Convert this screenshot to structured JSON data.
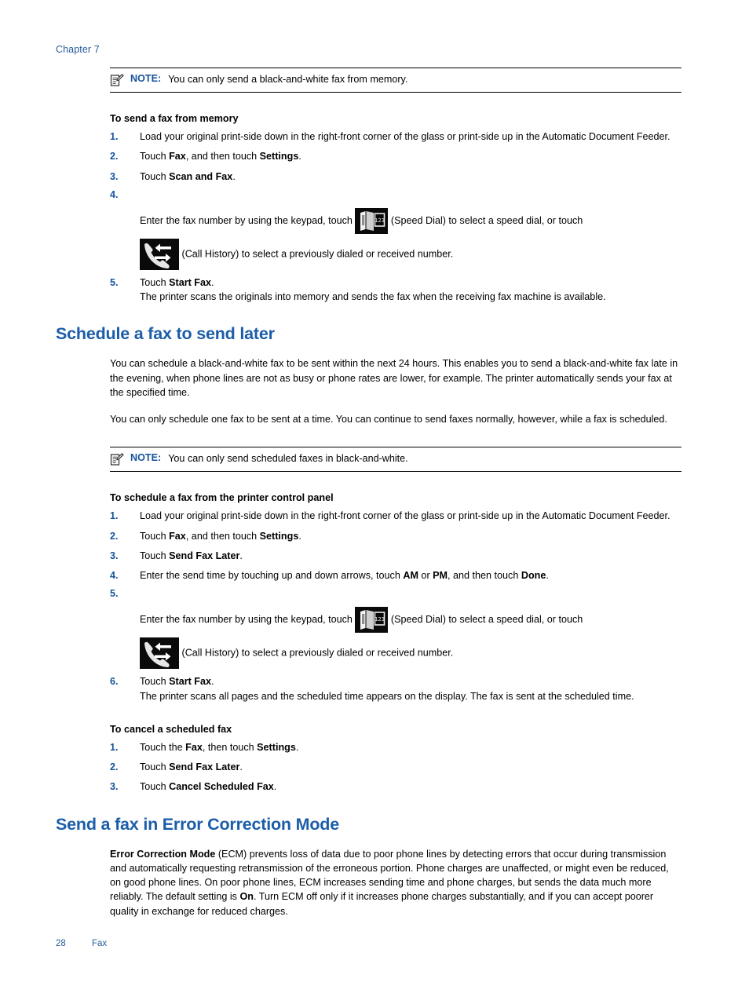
{
  "header": {
    "chapter": "Chapter 7"
  },
  "notes": [
    {
      "label": "NOTE:",
      "text": "You can only send a black-and-white fax from memory.",
      "icon": "note-pad-icon"
    },
    {
      "label": "NOTE:",
      "text": "You can only send scheduled faxes in black-and-white.",
      "icon": "note-pad-icon"
    }
  ],
  "procedures": [
    {
      "title": "To send a fax from memory",
      "steps": [
        {
          "num": "1.",
          "html": "Load your original print-side down in the right-front corner of the glass or print-side up in the Automatic Document Feeder."
        },
        {
          "num": "2.",
          "html": "Touch <b>Fax</b>, and then touch <b>Settings</b>."
        },
        {
          "num": "3.",
          "html": "Touch <b>Scan and Fax</b>."
        },
        {
          "num": "4.",
          "icon_step": true,
          "line1_before": "Enter the fax number by using the keypad, touch ",
          "line1_after": " (Speed Dial) to select a speed dial, or touch",
          "line2_after": " (Call History) to select a previously dialed or received number."
        },
        {
          "num": "5.",
          "html": "Touch <b>Start Fax</b>.",
          "sub": "The printer scans the originals into memory and sends the fax when the receiving fax machine is available."
        }
      ]
    },
    {
      "title": "To schedule a fax from the printer control panel",
      "steps": [
        {
          "num": "1.",
          "html": "Load your original print-side down in the right-front corner of the glass or print-side up in the Automatic Document Feeder."
        },
        {
          "num": "2.",
          "html": "Touch <b>Fax</b>, and then touch <b>Settings</b>."
        },
        {
          "num": "3.",
          "html": "Touch <b>Send Fax Later</b>."
        },
        {
          "num": "4.",
          "html": "Enter the send time by touching up and down arrows, touch <b>AM</b> or <b>PM</b>, and then touch <b>Done</b>."
        },
        {
          "num": "5.",
          "icon_step": true,
          "line1_before": "Enter the fax number by using the keypad, touch ",
          "line1_after": " (Speed Dial) to select a speed dial, or touch",
          "line2_after": " (Call History) to select a previously dialed or received number."
        },
        {
          "num": "6.",
          "html": "Touch <b>Start Fax</b>.",
          "sub": "The printer scans all pages and the scheduled time appears on the display. The fax is sent at the scheduled time."
        }
      ]
    },
    {
      "title": "To cancel a scheduled fax",
      "steps": [
        {
          "num": "1.",
          "html": "Touch the <b>Fax</b>, then touch <b>Settings</b>."
        },
        {
          "num": "2.",
          "html": "Touch <b>Send Fax Later</b>."
        },
        {
          "num": "3.",
          "html": "Touch <b>Cancel Scheduled Fax</b>."
        }
      ]
    }
  ],
  "sections": [
    {
      "heading": "Schedule a fax to send later",
      "paragraphs": [
        "You can schedule a black-and-white fax to be sent within the next 24 hours. This enables you to send a black-and-white fax late in the evening, when phone lines are not as busy or phone rates are lower, for example. The printer automatically sends your fax at the specified time.",
        "You can only schedule one fax to be sent at a time. You can continue to send faxes normally, however, while a fax is scheduled."
      ]
    },
    {
      "heading": "Send a fax in Error Correction Mode",
      "paragraphs_html": [
        "<b>Error Correction Mode</b> (ECM) prevents loss of data due to poor phone lines by detecting errors that occur during transmission and automatically requesting retransmission of the erroneous portion. Phone charges are unaffected, or might even be reduced, on good phone lines. On poor phone lines, ECM increases sending time and phone charges, but sends the data much more reliably. The default setting is <b>On</b>. Turn ECM off only if it increases phone charges substantially, and if you can accept poorer quality in exchange for reduced charges."
      ]
    }
  ],
  "icons": {
    "speed_dial": "speed-dial-icon",
    "call_history": "call-history-icon",
    "speed_dial_digits": "123"
  },
  "footer": {
    "page_number": "28",
    "section_label": "Fax"
  },
  "colors": {
    "heading_blue": "#1b5da8",
    "accent_blue": "#15539b",
    "header_blue": "#2a5c9a",
    "text_black": "#000000"
  }
}
